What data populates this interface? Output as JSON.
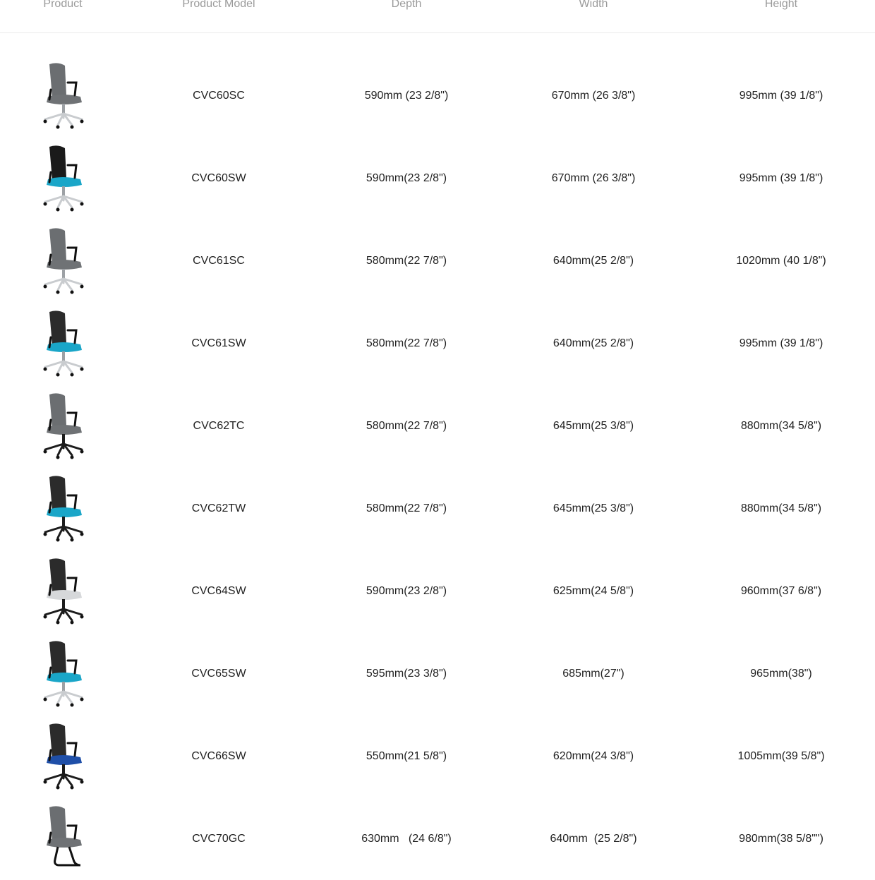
{
  "header": {
    "product": "Product",
    "model": "Product Model",
    "depth": "Depth",
    "width": "Width",
    "height": "Height"
  },
  "rows": [
    {
      "model": "CVC60SC",
      "depth": "590mm (23 2/8\")",
      "width": "670mm (26 3/8\")",
      "height": "995mm (39 1/8\")",
      "image": "office-chair-image",
      "back": "#6b6e71",
      "seat": "#6f7275",
      "base": "chrome"
    },
    {
      "model": "CVC60SW",
      "depth": "590mm(23 2/8\")",
      "width": "670mm (26 3/8\")",
      "height": "995mm (39 1/8\")",
      "image": "office-chair-image",
      "back": "#1a1a1a",
      "seat": "#1aa6c8",
      "base": "chrome"
    },
    {
      "model": "CVC61SC",
      "depth": "580mm(22 7/8\")",
      "width": "640mm(25 2/8\")",
      "height": "1020mm (40 1/8\")",
      "image": "office-chair-image",
      "back": "#6b6e71",
      "seat": "#6f7275",
      "base": "chrome"
    },
    {
      "model": "CVC61SW",
      "depth": "580mm(22 7/8\")",
      "width": "640mm(25 2/8\")",
      "height": "995mm (39 1/8\")",
      "image": "office-chair-image",
      "back": "#2b2b2b",
      "seat": "#1aa6c8",
      "base": "chrome"
    },
    {
      "model": "CVC62TC",
      "depth": "580mm(22 7/8\")",
      "width": "645mm(25 3/8\")",
      "height": "880mm(34 5/8\")",
      "image": "office-chair-image",
      "back": "#6b6e71",
      "seat": "#6f7275",
      "base": "black"
    },
    {
      "model": "CVC62TW",
      "depth": "580mm(22 7/8\")",
      "width": "645mm(25 3/8\")",
      "height": "880mm(34 5/8\")",
      "image": "office-chair-image",
      "back": "#2b2b2b",
      "seat": "#1aa6c8",
      "base": "black"
    },
    {
      "model": "CVC64SW",
      "depth": "590mm(23 2/8\")",
      "width": "625mm(24 5/8\")",
      "height": "960mm(37 6/8\")",
      "image": "office-chair-image",
      "back": "#2b2b2b",
      "seat": "#d6d8da",
      "base": "black"
    },
    {
      "model": "CVC65SW",
      "depth": "595mm(23 3/8\")",
      "width": "685mm(27\")",
      "height": "965mm(38\")",
      "image": "office-chair-image",
      "back": "#2b2b2b",
      "seat": "#1aa6c8",
      "base": "chrome"
    },
    {
      "model": "CVC66SW",
      "depth": "550mm(21 5/8\")",
      "width": "620mm(24 3/8\")",
      "height": "1005mm(39 5/8\")",
      "image": "office-chair-image",
      "back": "#2b2b2b",
      "seat": "#1f4fa8",
      "base": "black"
    },
    {
      "model": "CVC70GC",
      "depth": "630mm   (24 6/8\")",
      "width": "640mm  (25 2/8\")",
      "height": "980mm(38 5/8\"\")",
      "image": "visitor-chair-image",
      "back": "#6b6e71",
      "seat": "#6f7275",
      "base": "sled"
    }
  ]
}
